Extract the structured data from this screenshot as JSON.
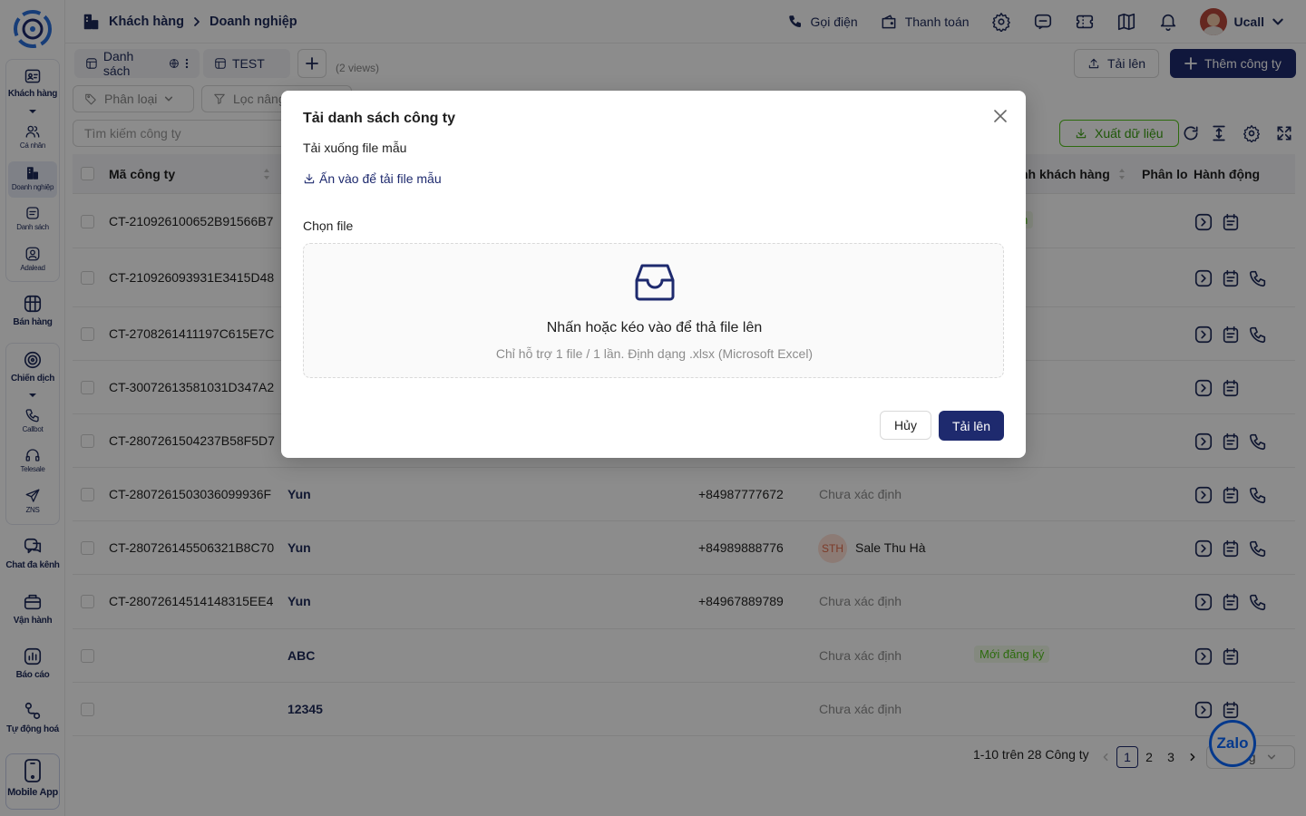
{
  "colors": {
    "primary": "#1e2a6e",
    "success": "#52c41a",
    "overlay": "rgba(0,0,0,0.45)"
  },
  "sidebar": {
    "items": [
      {
        "label": "Khách hàng",
        "icon": "customer-card-icon"
      },
      {
        "label": "Cá nhân",
        "icon": "people-icon"
      },
      {
        "label": "Doanh nghiệp",
        "icon": "building-icon"
      },
      {
        "label": "Danh sách",
        "icon": "list-icon"
      },
      {
        "label": "Adalead",
        "icon": "user-circle-icon"
      },
      {
        "label": "Bán hàng",
        "icon": "store-icon"
      },
      {
        "label": "Chiến dịch",
        "icon": "target-icon"
      },
      {
        "label": "Callbot",
        "icon": "phone-icon"
      },
      {
        "label": "Telesale",
        "icon": "headset-icon"
      },
      {
        "label": "ZNS",
        "icon": "send-icon"
      },
      {
        "label": "Chat đa kênh",
        "icon": "chat-icon"
      },
      {
        "label": "Vận hành",
        "icon": "briefcase-icon"
      },
      {
        "label": "Báo cáo",
        "icon": "report-icon"
      },
      {
        "label": "Tự động hoá",
        "icon": "automation-icon"
      },
      {
        "label": "Mobile App",
        "icon": "mobile-icon"
      }
    ]
  },
  "header": {
    "breadcrumb": [
      "Khách hàng",
      "Doanh nghiệp"
    ],
    "call_label": "Gọi điện",
    "payment_label": "Thanh toán",
    "user_name": "Ucall"
  },
  "toolbar": {
    "tabs": [
      "Danh sách",
      "TEST"
    ],
    "views_count": "(2 views)",
    "upload_label": "Tải lên",
    "add_company_label": "Thêm công ty",
    "filter_category": "Phân loại",
    "filter_advanced": "Lọc nâng cao",
    "search_placeholder": "Tìm kiếm công ty",
    "export_label": "Xuất dữ liệu"
  },
  "table": {
    "headers": {
      "code": "Mã công ty",
      "owner": "nh khách hàng",
      "category": "Phân lo",
      "actions": "Hành động"
    },
    "rows": [
      {
        "code": "CT-210926100652B91566B7",
        "name": "",
        "phone": "",
        "assignee": "",
        "tag": "h"
      },
      {
        "code": "CT-210926093931E3415D48",
        "name": "",
        "phone": "",
        "assignee": "",
        "tag": ""
      },
      {
        "code": "CT-2708261411197C615E7C",
        "name": "",
        "phone": "",
        "assignee": "",
        "tag": ""
      },
      {
        "code": "CT-30072613581031D347A2",
        "name": "",
        "phone": "",
        "assignee": "",
        "tag": ""
      },
      {
        "code": "CT-2807261504237B58F5D7",
        "name": "",
        "phone": "",
        "assignee": "",
        "tag": ""
      },
      {
        "code": "CT-2807261503036099936F",
        "name": "Yun",
        "phone": "+84987777672",
        "assignee": "Chưa xác định",
        "tag": ""
      },
      {
        "code": "CT-280726145506321B8C70",
        "name": "Yun",
        "phone": "+84989888776",
        "assignee": "Sale Thu Hà",
        "avatar": "STH",
        "tag": ""
      },
      {
        "code": "CT-28072614514148315EE4",
        "name": "Yun",
        "phone": "+84967889789",
        "assignee": "Chưa xác định",
        "tag": ""
      },
      {
        "code": "",
        "name": "ABC",
        "phone": "",
        "assignee": "Chưa xác định",
        "tag": "Mới đăng ký"
      },
      {
        "code": "",
        "name": "12345",
        "phone": "",
        "assignee": "Chưa xác định",
        "tag": ""
      }
    ]
  },
  "pagination": {
    "summary": "1-10 trên 28 Công ty",
    "pages": [
      "1",
      "2",
      "3"
    ],
    "page_size": "ng"
  },
  "zalo_label": "Zalo",
  "modal": {
    "title": "Tải danh sách công ty",
    "download_label": "Tải xuống file mẫu",
    "download_link": "Ấn vào để tải file mẫu",
    "choose_file_label": "Chọn file",
    "drop_text": "Nhấn hoặc kéo vào để thả file lên",
    "drop_hint": "Chỉ hỗ trợ 1 file / 1 lần. Định dạng .xlsx (Microsoft Excel)",
    "cancel_label": "Hủy",
    "upload_label": "Tải lên"
  }
}
